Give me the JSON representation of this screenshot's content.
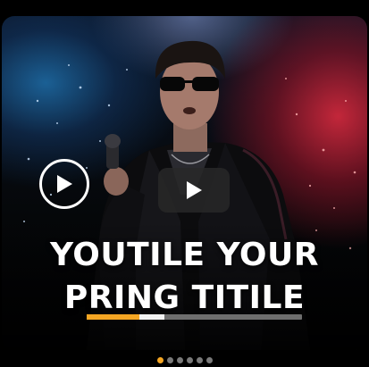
{
  "video": {
    "title_line1": "YOUTILE YOUR",
    "title_line2": "PRING TITILE",
    "progress_played": 0.245,
    "progress_buffered": 0.36,
    "colors": {
      "accent": "#f5a623",
      "track": "#6e6e6e",
      "buffered": "#f2f2f2"
    }
  },
  "controls": {
    "play_icon": "play-icon",
    "center_play_icon": "play-icon"
  },
  "pagination": {
    "count": 6,
    "active_index": 0
  }
}
